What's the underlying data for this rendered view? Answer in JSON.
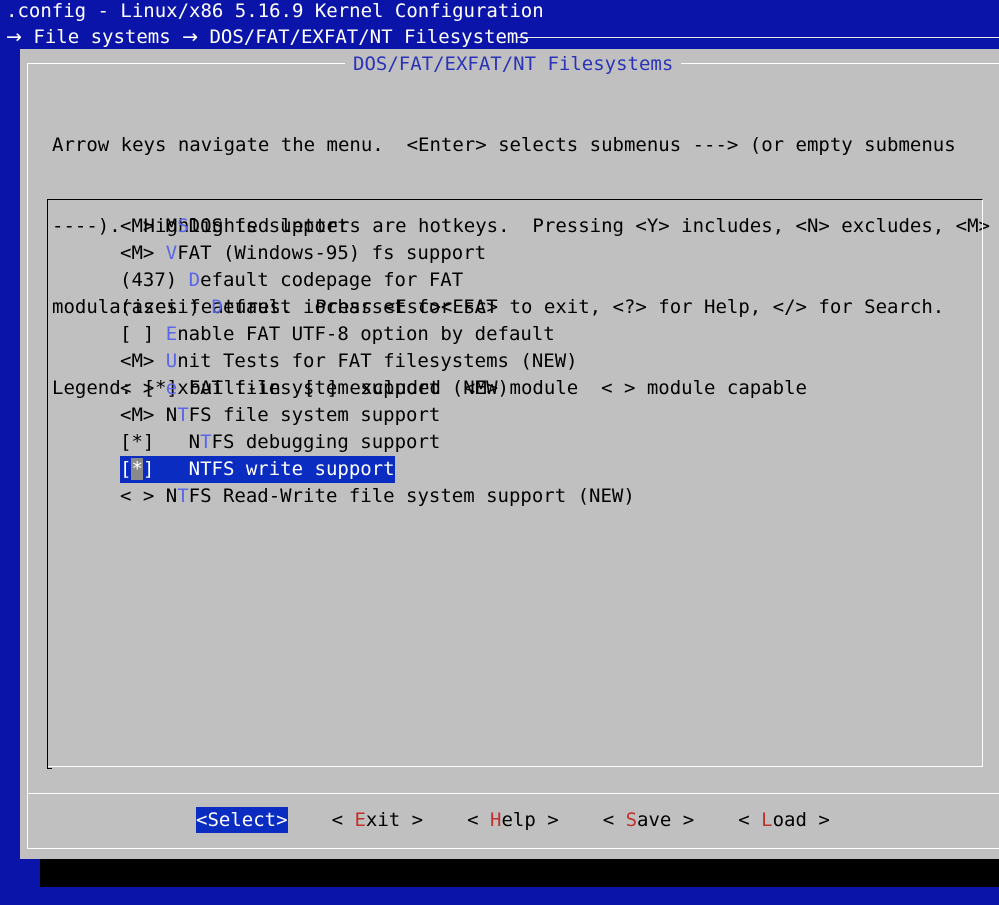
{
  "window": {
    "title": ".config - Linux/x86 5.16.9 Kernel Configuration",
    "breadcrumb": [
      "File systems",
      "DOS/FAT/EXFAT/NT Filesystems"
    ],
    "breadcrumb_arrow": "→"
  },
  "dialog": {
    "title": "DOS/FAT/EXFAT/NT Filesystems",
    "help_lines": [
      "Arrow keys navigate the menu.  <Enter> selects submenus ---> (or empty submenus",
      "----).  Highlighted letters are hotkeys.  Pressing <Y> includes, <N> excludes, <M>",
      "modularizes features.  Press <Esc><Esc> to exit, <?> for Help, </> for Search.",
      "Legend: [*] built-in  [ ] excluded  <M> module  < > module capable"
    ]
  },
  "menu": {
    "items": [
      {
        "prefix": "<M> ",
        "pre": "M",
        "hot": "S",
        "post": "DOS fs support"
      },
      {
        "prefix": "<M> ",
        "pre": "",
        "hot": "V",
        "post": "FAT (Windows-95) fs support"
      },
      {
        "prefix": "(437) ",
        "pre": "",
        "hot": "D",
        "post": "efault codepage for FAT"
      },
      {
        "prefix": "(ascii) ",
        "pre": "",
        "hot": "D",
        "post": "efault iocharset for FAT"
      },
      {
        "prefix": "[ ] ",
        "pre": "",
        "hot": "E",
        "post": "nable FAT UTF-8 option by default"
      },
      {
        "prefix": "<M> ",
        "pre": "",
        "hot": "U",
        "post": "nit Tests for FAT filesystems (NEW)"
      },
      {
        "prefix": "< > ",
        "pre": "",
        "hot": "e",
        "post": "xFAT filesystem support (NEW)"
      },
      {
        "prefix": "<M> ",
        "pre": "N",
        "hot": "T",
        "post": "FS file system support"
      },
      {
        "prefix": "[*]   ",
        "pre": "N",
        "hot": "T",
        "post": "FS debugging support"
      },
      {
        "prefix": "[*]   ",
        "pre": "",
        "hot": "",
        "post": "NTFS write support",
        "selected": true
      },
      {
        "prefix": "< > ",
        "pre": "N",
        "hot": "T",
        "post": "FS Read-Write file system support (NEW)"
      }
    ]
  },
  "buttons": [
    {
      "left": "<",
      "hot": "S",
      "rest": "elect",
      "right": ">",
      "selected": true
    },
    {
      "left": "< ",
      "hot": "E",
      "rest": "xit",
      "right": " >"
    },
    {
      "left": "< ",
      "hot": "H",
      "rest": "elp",
      "right": " >"
    },
    {
      "left": "< ",
      "hot": "S",
      "rest": "ave",
      "right": " >"
    },
    {
      "left": "< ",
      "hot": "L",
      "rest": "oad",
      "right": " >"
    }
  ],
  "colors": {
    "background": "#0a14a8",
    "dialog": "#c0c0c0",
    "highlight": "#0a2cc0",
    "menu_hotkey": "#5a66e8",
    "button_hotkey": "#c0302a"
  }
}
